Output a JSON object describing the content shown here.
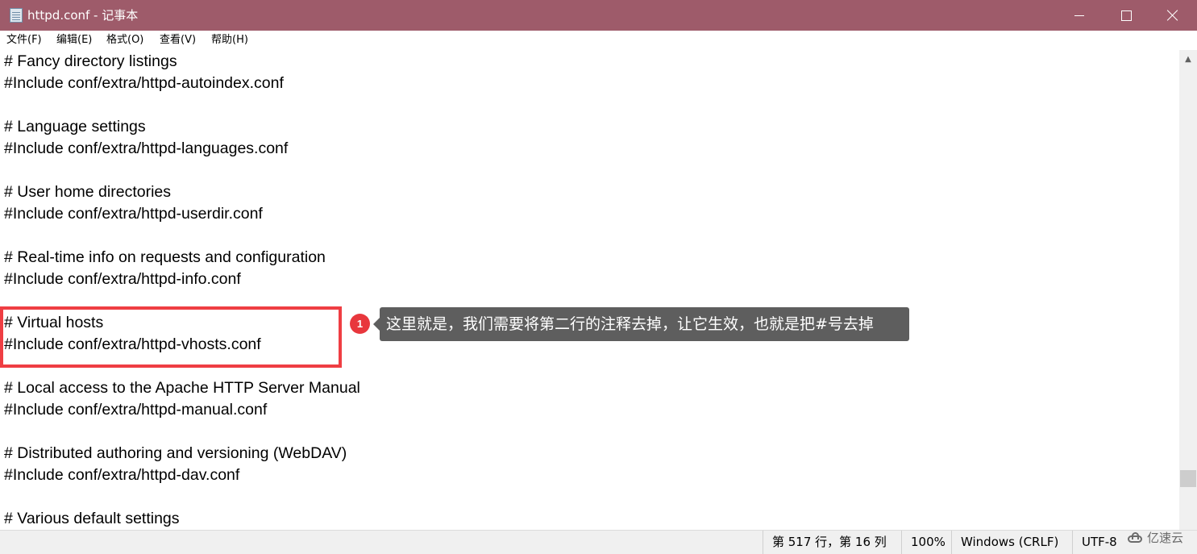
{
  "window": {
    "title": "httpd.conf - 记事本",
    "titlebar_color": "#9e5b6a",
    "icon": "notepad-icon",
    "controls": [
      "minimize-icon",
      "maximize-icon",
      "close-icon"
    ]
  },
  "menu": [
    "文件(F)",
    "编辑(E)",
    "格式(O)",
    "查看(V)",
    "帮助(H)"
  ],
  "editor": {
    "lines": [
      "# Fancy directory listings",
      "#Include conf/extra/httpd-autoindex.conf",
      "",
      "# Language settings",
      "#Include conf/extra/httpd-languages.conf",
      "",
      "# User home directories",
      "#Include conf/extra/httpd-userdir.conf",
      "",
      "# Real-time info on requests and configuration",
      "#Include conf/extra/httpd-info.conf",
      "",
      "# Virtual hosts",
      "#Include conf/extra/httpd-vhosts.conf",
      "",
      "# Local access to the Apache HTTP Server Manual",
      "#Include conf/extra/httpd-manual.conf",
      "",
      "# Distributed authoring and versioning (WebDAV)",
      "#Include conf/extra/httpd-dav.conf",
      "",
      "# Various default settings"
    ]
  },
  "annotation": {
    "badge": "1",
    "text": "这里就是，我们需要将第二行的注释去掉，让它生效，也就是把#号去掉",
    "highlight_color": "#ef3e43"
  },
  "status": {
    "position": "第 517 行，第 16 列",
    "zoom": "100%",
    "line_ending": "Windows (CRLF)",
    "encoding": "UTF-8"
  },
  "watermark": {
    "text": "亿速云",
    "icon": "cloud-icon"
  }
}
